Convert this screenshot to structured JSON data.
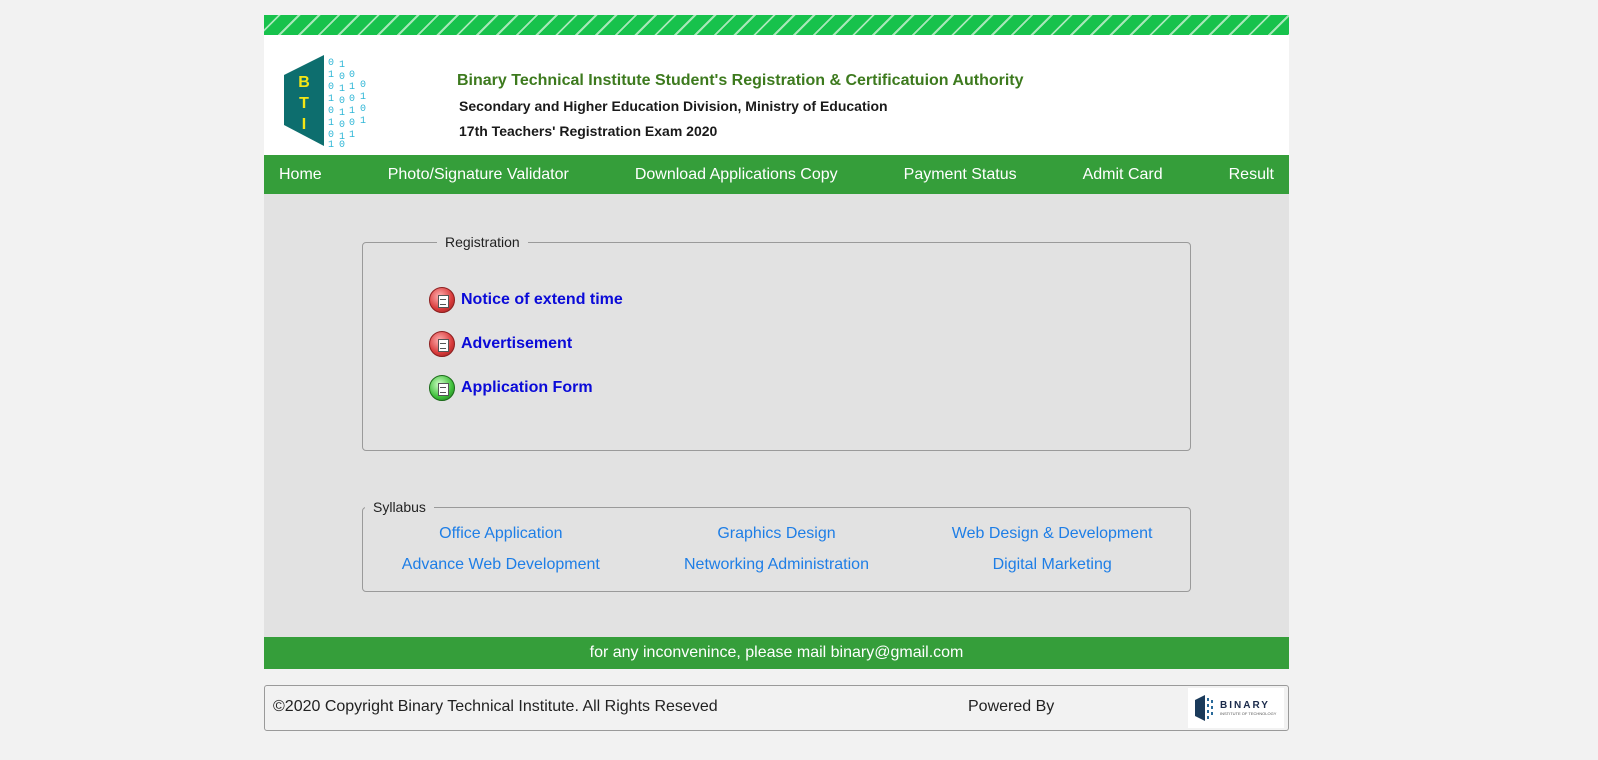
{
  "header": {
    "logo_letters": [
      "B",
      "T",
      "I"
    ],
    "title": "Binary Technical Institute Student's Registration & Certificatuion Authority",
    "subtitle": "Secondary and Higher Education Division, Ministry of Education",
    "exam": "17th Teachers' Registration Exam 2020"
  },
  "nav": {
    "items": [
      "Home",
      "Photo/Signature Validator",
      "Download Applications Copy",
      "Payment Status",
      "Admit Card",
      "Result"
    ]
  },
  "registration": {
    "legend": "Registration",
    "items": [
      {
        "label": "Notice of extend time",
        "icon": "document-red-icon"
      },
      {
        "label": "Advertisement",
        "icon": "document-red-icon"
      },
      {
        "label": "Application Form",
        "icon": "document-green-icon"
      }
    ]
  },
  "syllabus": {
    "legend": "Syllabus",
    "items": [
      "Office Application",
      "Graphics Design",
      "Web Design & Development",
      "Advance Web Development",
      "Networking Administration",
      "Digital Marketing"
    ]
  },
  "mailbar": "for any inconvenince, please mail binary@gmail.com",
  "footer": {
    "copyright": "©2020 Copyright Binary Technical Institute. All Rights Reseved",
    "powered": "Powered By",
    "brand": "BINARY",
    "brand_tagline": "INSTITUTE OF TECHNOLOGY"
  },
  "colors": {
    "nav_green": "#359e3a",
    "stripe_green": "#17c24c",
    "link_blue": "#0a0ad8",
    "syllabus_blue": "#1e7ee6",
    "title_green": "#3d7a1e"
  }
}
